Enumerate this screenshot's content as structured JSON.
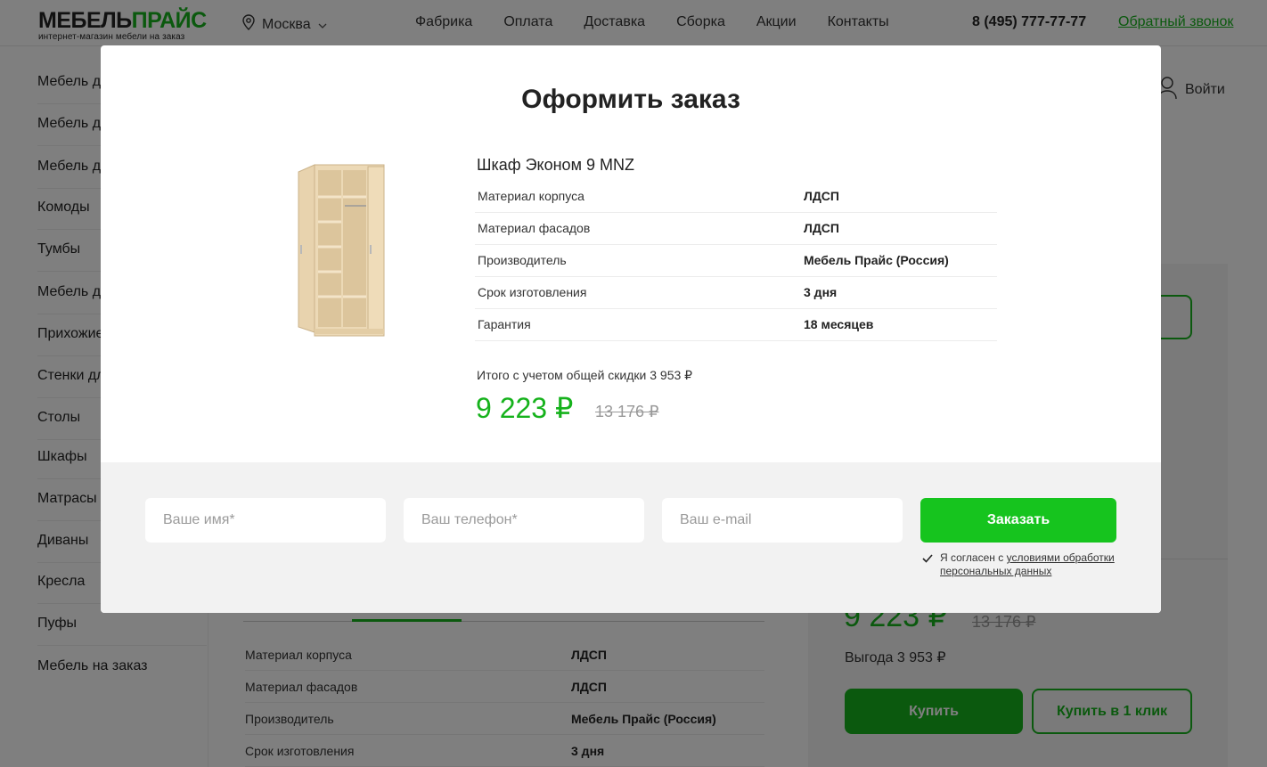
{
  "header": {
    "logo_part1": "МЕБЕЛЬ",
    "logo_part2": "ПРАЙС",
    "logo_subtitle": "интернет-магазин мебели на заказ",
    "city": "Москва",
    "nav": [
      "Фабрика",
      "Оплата",
      "Доставка",
      "Сборка",
      "Акции",
      "Контакты"
    ],
    "phone": "8 (495) 777-77-77",
    "callback": "Обратный звонок",
    "login": "Войти"
  },
  "sidebar": {
    "items": [
      "Мебель дл",
      "Мебель дл",
      "Мебель дл",
      "Комоды",
      "Тумбы",
      "Мебель дл",
      "Прихожие",
      "Стенки дл",
      "Столы",
      "Шкафы",
      "Матрасы",
      "Диваны",
      "Кресла",
      "Пуфы",
      "Мебель на заказ"
    ]
  },
  "background_product": {
    "price": "9 223 ₽",
    "old_price": "13 176 ₽",
    "benefit": "Выгода 3 953 ₽",
    "buy_label": "Купить",
    "buy_one_click_label": "Купить в 1 клик",
    "specs": [
      {
        "k": "Материал корпуса",
        "v": "ЛДСП"
      },
      {
        "k": "Материал фасадов",
        "v": "ЛДСП"
      },
      {
        "k": "Производитель",
        "v": "Мебель Прайс (Россия)"
      },
      {
        "k": "Срок изготовления",
        "v": "3 дня"
      }
    ]
  },
  "modal": {
    "title": "Оформить заказ",
    "product_name": "Шкаф Эконом 9 MNZ",
    "specs": [
      {
        "k": "Материал корпуса",
        "v": "ЛДСП"
      },
      {
        "k": "Материал фасадов",
        "v": "ЛДСП"
      },
      {
        "k": "Производитель",
        "v": "Мебель Прайс (Россия)"
      },
      {
        "k": "Срок изготовления",
        "v": "3 дня"
      },
      {
        "k": "Гарантия",
        "v": "18 месяцев"
      }
    ],
    "total_label": "Итого с учетом общей скидки 3 953 ₽",
    "price": "9 223 ₽",
    "old_price": "13 176 ₽",
    "form": {
      "name_placeholder": "Ваше имя*",
      "phone_placeholder": "Ваш телефон*",
      "email_placeholder": "Ваш e-mail",
      "submit_label": "Заказать",
      "consent_prefix": "Я согласен с ",
      "consent_link": "условиями обработки персональных данных",
      "consent_checked": true
    }
  },
  "colors": {
    "accent": "#16c41e",
    "price": "#16b21c",
    "overlay": "rgba(0,0,0,0.5)"
  }
}
